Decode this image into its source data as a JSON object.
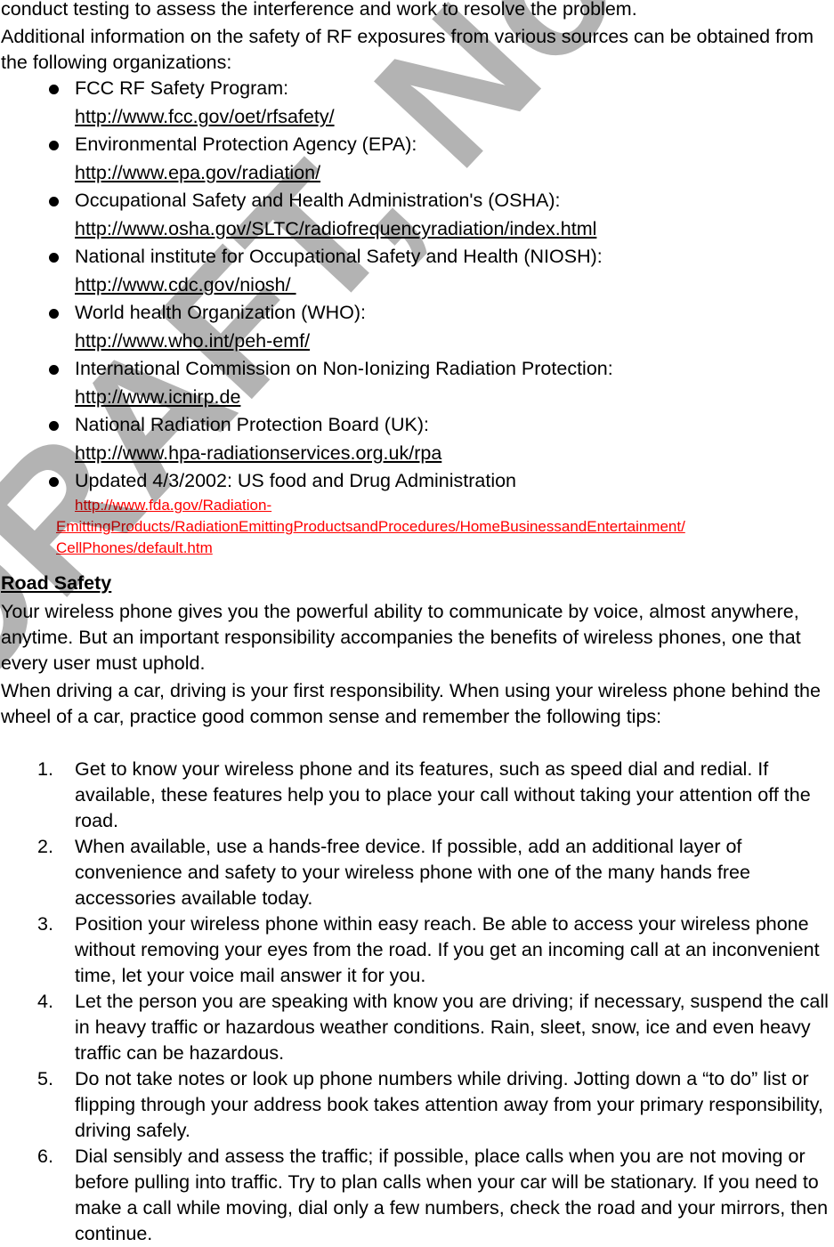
{
  "intro": {
    "line1": "conduct testing to assess the interference and work to resolve the problem.",
    "line2": "Additional information on the safety of RF exposures from various sources can be obtained from the following organizations:"
  },
  "organizations": [
    {
      "name": "FCC RF Safety Program:",
      "url": "http://www.fcc.gov/oet/rfsafety/"
    },
    {
      "name": "Environmental Protection Agency (EPA):",
      "url": "http://www.epa.gov/radiation/"
    },
    {
      "name": "Occupational Safety and Health Administration's (OSHA):",
      "url": "http://www.osha.gov/SLTC/radiofrequencyradiation/index.html"
    },
    {
      "name": "National institute for Occupational Safety and Health (NIOSH):",
      "url": "http://www.cdc.gov/niosh/ "
    },
    {
      "name": "World health Organization (WHO):",
      "url": "http://www.who.int/peh-emf/"
    },
    {
      "name": "International Commission on Non-Ionizing Radiation Protection:",
      "url": "http://www.icnirp.de"
    },
    {
      "name": "National Radiation Protection Board (UK):",
      "url": "http://www.hpa-radiationservices.org.uk/rpa"
    },
    {
      "name": "Updated 4/3/2002: US food and Drug Administration"
    }
  ],
  "fda_url": {
    "line1": "http://www.fda.gov/Radiation-",
    "line2": "EmittingProducts/RadiationEmittingProductsandProcedures/HomeBusinessandEntertainment/",
    "line3": "CellPhones/default.htm",
    "color": "#ff0000"
  },
  "road_safety": {
    "heading": "Road Safety",
    "para1": "Your wireless phone gives you the powerful ability to communicate by voice, almost anywhere, anytime. But an important responsibility accompanies the benefits of wireless phones, one that every user must uphold.",
    "para2": "When driving a car, driving is your first responsibility. When using your wireless phone behind the wheel of a car, practice good common sense and remember the following tips:",
    "tips": [
      {
        "num": "1.",
        "text": "Get to know your wireless phone and its features, such as speed dial and redial. If available, these features help you to place your call without taking your attention off the road."
      },
      {
        "num": "2.",
        "text": "When available, use a hands-free device. If possible, add an additional layer of convenience and safety to your wireless phone with one of the many hands free accessories available today."
      },
      {
        "num": "3.",
        "text": "Position your wireless phone within easy reach. Be able to access your wireless phone without removing your eyes from the road. If you get an incoming call at an inconvenient time, let your voice mail answer it for you."
      },
      {
        "num": "4.",
        "text": "Let the person you are speaking with know you are driving; if necessary, suspend the call in heavy traffic or hazardous weather conditions. Rain, sleet, snow, ice and even heavy traffic can be hazardous."
      },
      {
        "num": "5.",
        "text": "Do not take notes or look up phone numbers while driving. Jotting down a “to do” list or flipping through your address book takes attention away from your primary responsibility, driving safely."
      },
      {
        "num": "6.",
        "text": "Dial sensibly and assess the traffic; if possible, place calls when you are not moving or before pulling into traffic. Try to plan calls when your car will be stationary. If you need to make a call while moving, dial only a few numbers, check the road and your mirrors, then continue."
      }
    ]
  },
  "watermark": {
    "text": "DRAFT, Not FINAL",
    "color": "#b3b3b3"
  }
}
